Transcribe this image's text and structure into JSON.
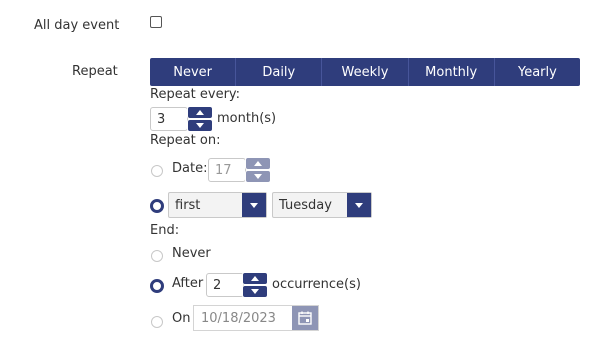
{
  "all_day": {
    "label": "All day event",
    "checked": false
  },
  "repeat": {
    "label": "Repeat",
    "options": [
      "Never",
      "Daily",
      "Weekly",
      "Monthly",
      "Yearly"
    ],
    "selected": "Monthly"
  },
  "repeat_every": {
    "label": "Repeat every:",
    "value": "3",
    "unit": "month(s)"
  },
  "repeat_on": {
    "label": "Repeat on:",
    "date_label": "Date:",
    "date_value": "17",
    "date_selected": false,
    "ordinal_value": "first",
    "weekday_value": "Tuesday",
    "weekday_selected": true
  },
  "end": {
    "label": "End:",
    "never_label": "Never",
    "after_label": "After",
    "after_value": "2",
    "occurrence_label": "occurrence(s)",
    "on_label": "On",
    "on_value": "10/18/2023",
    "selected": "after"
  },
  "colors": {
    "accent": "#2f3d7c",
    "disabled": "#8e95b5"
  },
  "icons": {
    "spinner_up": "triangle-up-icon",
    "spinner_down": "triangle-down-icon",
    "dropdown": "triangle-down-icon",
    "calendar": "calendar-icon"
  }
}
